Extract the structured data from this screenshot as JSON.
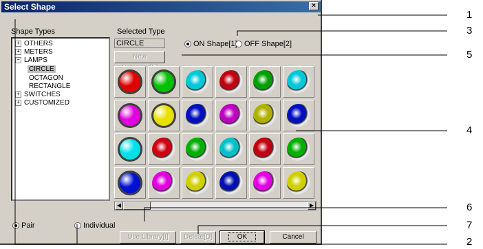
{
  "dialog": {
    "title": "Select Shape",
    "close_glyph": "×",
    "shape_types_label": "Shape Types",
    "selected_type_label": "Selected Type",
    "selected_type_value": "CIRCLE",
    "on_shape_label": "ON Shape[1]",
    "off_shape_label": "OFF Shape[2]",
    "on_shape_selected": true,
    "new_category_label": "New Category[E]",
    "pair_label": "Pair",
    "individual_label": "Individual",
    "pair_selected": true,
    "use_library_label": "Use Library[I]",
    "delete_label": "Delete[D]",
    "ok_label": "OK",
    "cancel_label": "Cancel"
  },
  "tree": [
    {
      "label": "OTHERS",
      "expander": "+"
    },
    {
      "label": "METERS",
      "expander": "+"
    },
    {
      "label": "LAMPS",
      "expander": "−"
    },
    {
      "label": "CIRCLE",
      "selected": true
    },
    {
      "label": "OCTAGON"
    },
    {
      "label": "RECTANGLE"
    },
    {
      "label": "SWITCHES",
      "expander": "+"
    },
    {
      "label": "CUSTOMIZED",
      "expander": "+"
    }
  ],
  "lamps": [
    [
      "#e00000",
      "#00c000",
      "#00c8d8",
      "#c00010",
      "#00a000",
      "#00c8d8"
    ],
    [
      "#e000e0",
      "#e8e000",
      "#0010c0",
      "#c000c0",
      "#b0b000",
      "#0010c0"
    ],
    [
      "#00e0e8",
      "#d00010",
      "#00b000",
      "#00c0c8",
      "#c00010",
      "#00b000"
    ],
    [
      "#0010d0",
      "#e000e0",
      "#d0d000",
      "#0010b0",
      "#e000e0",
      "#d0d000"
    ]
  ],
  "callouts": {
    "c1": "1",
    "c2": "2",
    "c3": "3",
    "c4": "4",
    "c5": "5",
    "c6": "6",
    "c7": "7"
  }
}
